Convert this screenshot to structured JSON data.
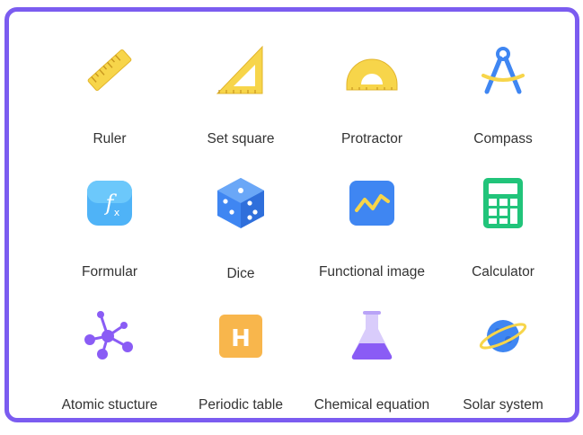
{
  "tools": [
    {
      "name": "ruler",
      "label": "Ruler",
      "icon": "ruler-icon"
    },
    {
      "name": "set-square",
      "label": "Set square",
      "icon": "set-square-icon"
    },
    {
      "name": "protractor",
      "label": "Protractor",
      "icon": "protractor-icon"
    },
    {
      "name": "compass",
      "label": "Compass",
      "icon": "compass-icon"
    },
    {
      "name": "formular",
      "label": "Formular",
      "icon": "formula-icon"
    },
    {
      "name": "dice",
      "label": "Dice",
      "icon": "dice-icon"
    },
    {
      "name": "functional-image",
      "label": "Functional image",
      "icon": "function-graph-icon"
    },
    {
      "name": "calculator",
      "label": "Calculator",
      "icon": "calculator-icon"
    },
    {
      "name": "atomic-structure",
      "label": "Atomic stucture",
      "icon": "molecule-icon"
    },
    {
      "name": "periodic-table",
      "label": "Periodic table",
      "icon": "periodic-table-icon"
    },
    {
      "name": "chemical-equation",
      "label": "Chemical equation",
      "icon": "flask-icon"
    },
    {
      "name": "solar-system",
      "label": "Solar system",
      "icon": "planet-icon"
    }
  ],
  "colors": {
    "border": "#7b5cf0",
    "yellow": "#f7d54a",
    "blue": "#3f86f2",
    "green": "#21c47a",
    "purple": "#8a5cf5",
    "orange": "#f8b64c"
  }
}
